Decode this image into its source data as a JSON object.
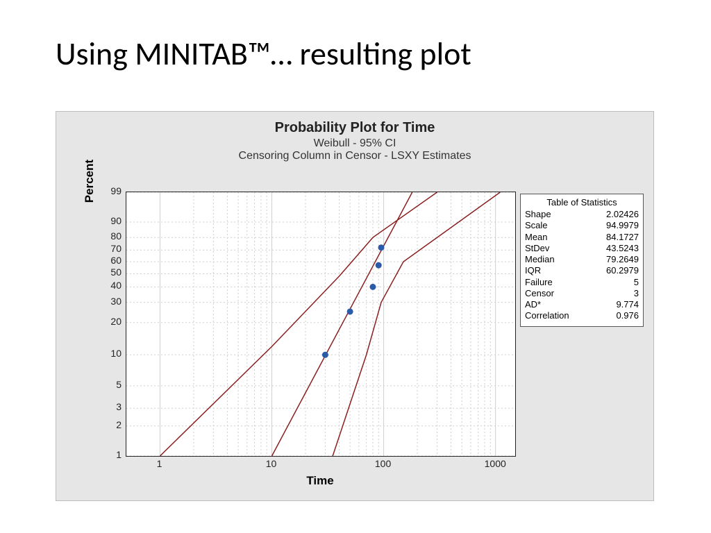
{
  "slide_title": "Using MINITAB™… resulting plot",
  "chart": {
    "title": "Probability Plot for Time",
    "subtitle1": "Weibull - 95% CI",
    "subtitle2": "Censoring Column in Censor - LSXY Estimates",
    "xlabel": "Time",
    "ylabel": "Percent"
  },
  "axes": {
    "x_ticks": [
      1,
      10,
      100,
      1000
    ],
    "y_ticks": [
      1,
      2,
      3,
      5,
      10,
      20,
      30,
      40,
      50,
      60,
      70,
      80,
      90,
      99
    ]
  },
  "stats": {
    "header": "Table of Statistics",
    "rows": [
      {
        "label": "Shape",
        "value": "2.02426"
      },
      {
        "label": "Scale",
        "value": "94.9979"
      },
      {
        "label": "Mean",
        "value": "84.1727"
      },
      {
        "label": "StDev",
        "value": "43.5243"
      },
      {
        "label": "Median",
        "value": "79.2649"
      },
      {
        "label": "IQR",
        "value": "60.2979"
      },
      {
        "label": "Failure",
        "value": "5"
      },
      {
        "label": "Censor",
        "value": "3"
      },
      {
        "label": "AD*",
        "value": "9.774"
      },
      {
        "label": "Correlation",
        "value": "0.976"
      }
    ]
  },
  "chart_data": {
    "type": "probability_plot",
    "distribution": "Weibull",
    "confidence_level": 0.95,
    "x_scale": "log10",
    "y_scale": "weibull_percent",
    "xlim": [
      0.5,
      1500
    ],
    "y_ticks": [
      1,
      2,
      3,
      5,
      10,
      20,
      30,
      40,
      50,
      60,
      70,
      80,
      90,
      99
    ],
    "points": [
      {
        "time": 30,
        "percent": 10
      },
      {
        "time": 50,
        "percent": 25
      },
      {
        "time": 80,
        "percent": 40
      },
      {
        "time": 90,
        "percent": 57
      },
      {
        "time": 95,
        "percent": 72
      }
    ],
    "fit_line_endpoints": {
      "x1": 10,
      "p1": 1,
      "x2": 180,
      "p2": 99
    },
    "ci_lower_poly_time": [
      1,
      10,
      40,
      80,
      300
    ],
    "ci_lower_poly_pct": [
      1,
      12,
      48,
      80,
      99
    ],
    "ci_upper_poly_time": [
      35,
      70,
      95,
      150,
      1100
    ],
    "ci_upper_poly_pct": [
      1,
      10,
      30,
      60,
      99
    ]
  }
}
